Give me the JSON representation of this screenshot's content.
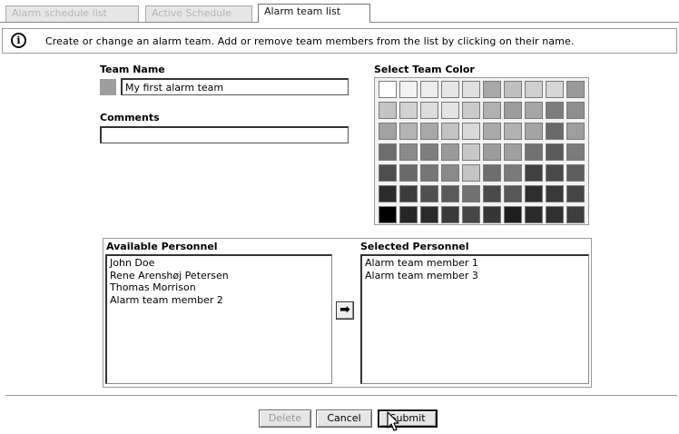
{
  "tabs": [
    {
      "label": "Alarm schedule list",
      "active": false
    },
    {
      "label": "Active Schedule",
      "active": false
    },
    {
      "label": "Alarm team list",
      "active": true
    }
  ],
  "info": {
    "icon": "info-icon",
    "text": "Create or change an alarm team. Add or remove team members from the list by clicking on their name."
  },
  "team_name": {
    "label": "Team Name",
    "value": "My first alarm team",
    "swatch_color": "#9e9e9e"
  },
  "comments": {
    "label": "Comments",
    "value": ""
  },
  "color_picker": {
    "label": "Select Team Color",
    "rows": [
      [
        "#ffffff",
        "#f2f2f2",
        "#ededed",
        "#e6e6e6",
        "#e0e0e0",
        "#a8a8a8",
        "#c0c0c0",
        "#cfcfcf",
        "#d6d6d6",
        "#9a9a9a"
      ],
      [
        "#c4c4c4",
        "#d2d2d2",
        "#dcdcdc",
        "#e3e3e3",
        "#cbcbcb",
        "#b0b0b0",
        "#9c9c9c",
        "#a6a6a6",
        "#7c7c7c",
        "#8e8e8e"
      ],
      [
        "#a2a2a2",
        "#b4b4b4",
        "#a8a8a8",
        "#c2c2c2",
        "#dadada",
        "#aaaaaa",
        "#b2b2b2",
        "#a4a4a4",
        "#6a6a6a",
        "#9e9e9e"
      ],
      [
        "#6e6e6e",
        "#8a8a8a",
        "#7e7e7e",
        "#9a9a9a",
        "#c8c8c8",
        "#9c9c9c",
        "#a0a0a0",
        "#727272",
        "#5a5a5a",
        "#7a7a7a"
      ],
      [
        "#4e4e4e",
        "#6a6a6a",
        "#767676",
        "#8a8a8a",
        "#c4c4c4",
        "#6e6e6e",
        "#7a7a7a",
        "#404040",
        "#4a4a4a",
        "#5e5e5e"
      ],
      [
        "#2c2c2c",
        "#3c3c3c",
        "#505050",
        "#5a5a5a",
        "#727272",
        "#4a4a4a",
        "#575757",
        "#2e2e2e",
        "#383838",
        "#454545"
      ],
      [
        "#000000",
        "#262626",
        "#2a2a2a",
        "#3a3a3a",
        "#464646",
        "#363636",
        "#1e1e1e",
        "#2a2a2a",
        "#303030",
        "#3e3e3e"
      ]
    ]
  },
  "available_personnel": {
    "label": "Available Personnel",
    "items": [
      "John Doe",
      "Rene Arenshøj Petersen",
      "Thomas Morrison",
      "Alarm team member 2"
    ]
  },
  "selected_personnel": {
    "label": "Selected Personnel",
    "items": [
      "Alarm team member 1",
      "Alarm team member 3"
    ]
  },
  "move_button": {
    "icon": "arrow-right-icon",
    "glyph": "➡"
  },
  "buttons": {
    "delete": "Delete",
    "cancel": "Cancel",
    "submit": "Submit"
  }
}
